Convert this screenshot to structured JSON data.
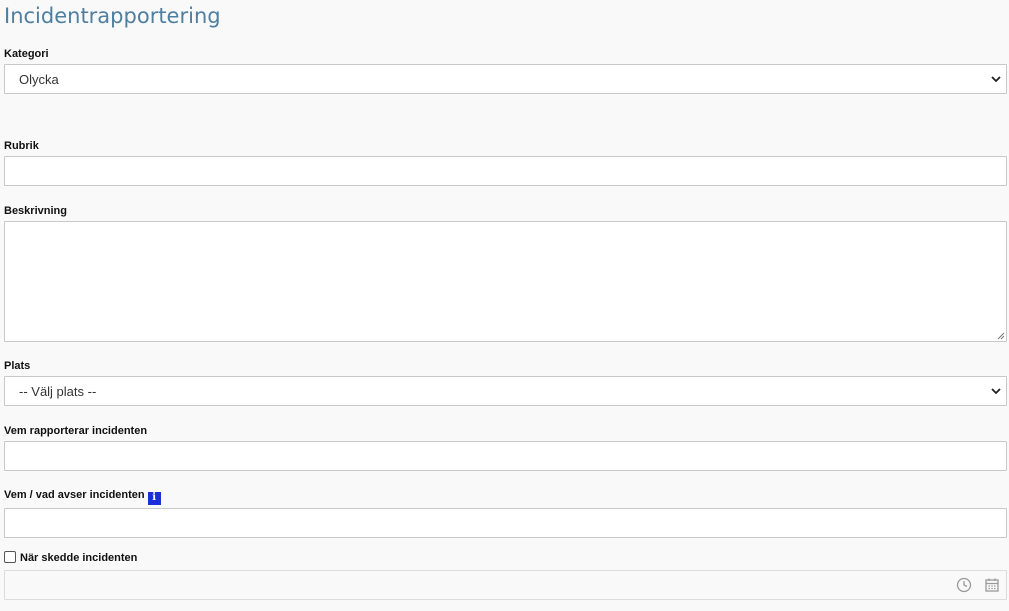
{
  "title": "Incidentrapportering",
  "kategori": {
    "label": "Kategori",
    "selected": "Olycka"
  },
  "rubrik": {
    "label": "Rubrik",
    "value": ""
  },
  "beskrivning": {
    "label": "Beskrivning",
    "value": ""
  },
  "plats": {
    "label": "Plats",
    "selected": "-- Välj plats --"
  },
  "reporter": {
    "label": "Vem rapporterar incidenten",
    "value": ""
  },
  "subject": {
    "label": "Vem / vad avser incidenten",
    "info_icon": "info-icon",
    "info_glyph": "i",
    "value": ""
  },
  "when": {
    "label": "När skedde incidenten",
    "checked": false,
    "value": "",
    "icons": [
      "clock-icon",
      "calendar-icon"
    ]
  },
  "colors": {
    "title": "#4f7fa0",
    "info_badge": "#1a2fd6",
    "border": "#c9c9c9"
  }
}
